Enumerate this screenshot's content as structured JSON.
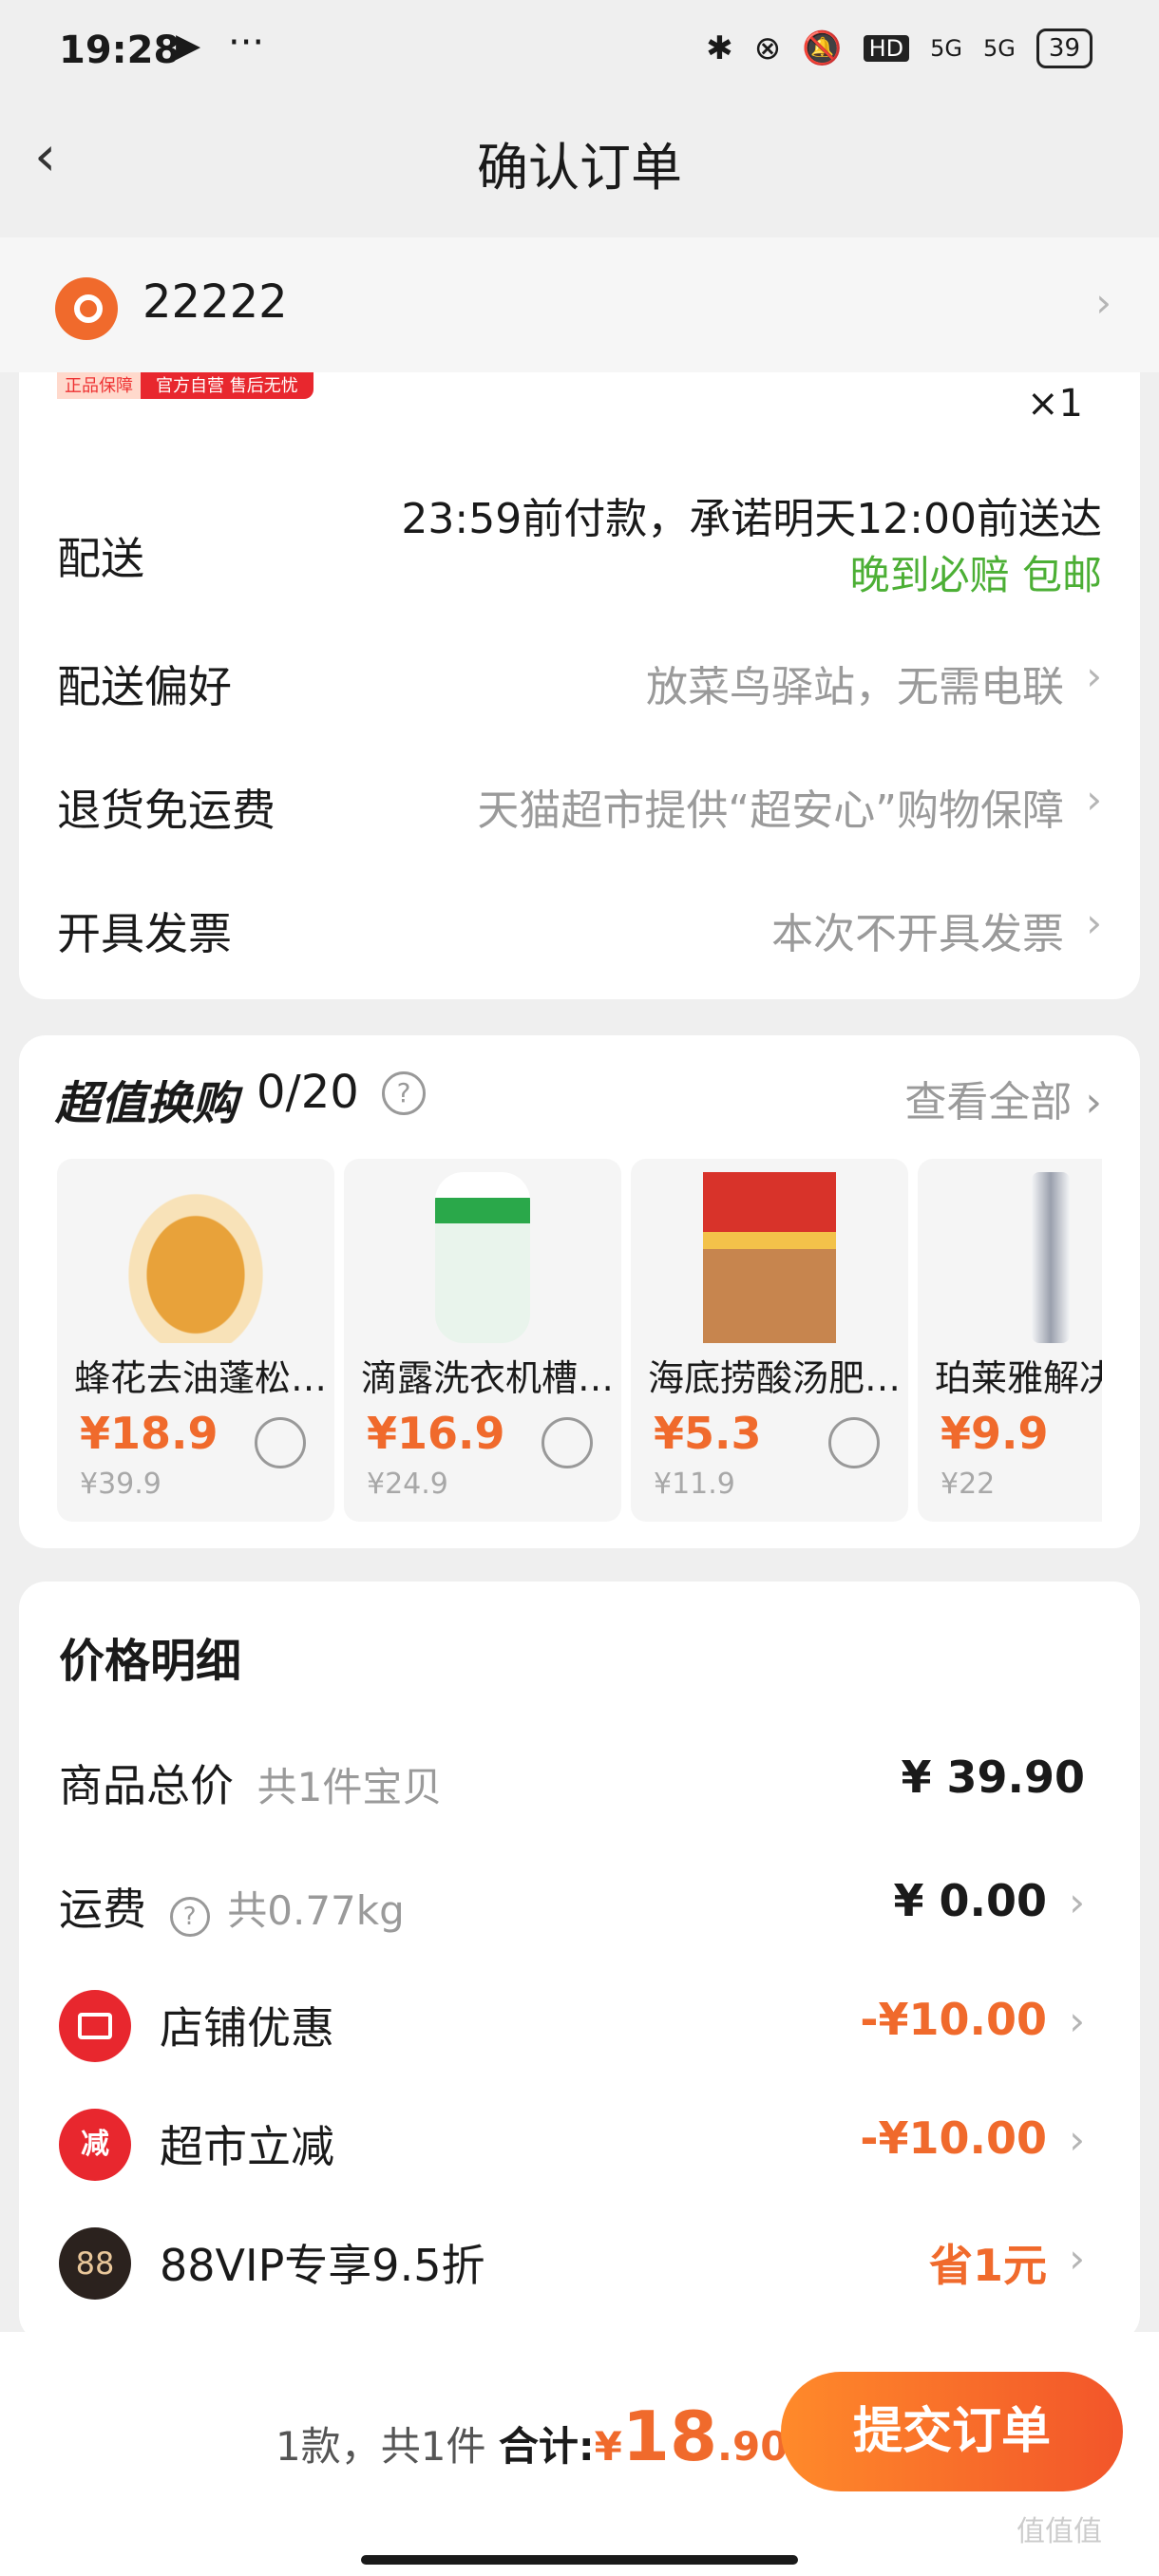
{
  "status": {
    "time": "19:28",
    "more": "···",
    "battery": "39",
    "hd": "HD",
    "net1": "5G",
    "net2": "5G"
  },
  "header": {
    "title": "确认订单",
    "back": "‹"
  },
  "address": {
    "text": "22222"
  },
  "badge": {
    "left": "正品保障",
    "right": "官方自营 售后无忧"
  },
  "item": {
    "qty": "×1"
  },
  "rows": {
    "delivery_label": "配送",
    "delivery_time": "23:59前付款，承诺明天12:00前送达",
    "delivery_promise": "晚到必赔 包邮",
    "pref_label": "配送偏好",
    "pref_value": "放菜鸟驿站，无需电联",
    "return_label": "退货免运费",
    "return_value": "天猫超市提供“超安心”购物保障",
    "invoice_label": "开具发票",
    "invoice_value": "本次不开具发票"
  },
  "swap": {
    "title": "超值换购",
    "count": "0/20",
    "view_all": "查看全部",
    "products": [
      {
        "name": "蜂花去油蓬松洗发水",
        "price": "¥18.9",
        "orig": "¥39.9",
        "color": "#e8a23a"
      },
      {
        "name": "滴露洗衣机槽清洗剂",
        "price": "¥16.9",
        "orig": "¥24.9",
        "color": "#2aa84a"
      },
      {
        "name": "海底捞酸汤肥牛调味料",
        "price": "¥5.3",
        "orig": "¥11.9",
        "color": "#d8332a"
      },
      {
        "name": "珀莱雅解决方案",
        "price": "¥9.9",
        "orig": "¥22",
        "color": "#9aa0ad"
      }
    ]
  },
  "price_detail": {
    "title": "价格明细",
    "goods_label": "商品总价",
    "goods_sub": "共1件宝贝",
    "goods_value": "¥ 39.90",
    "ship_label": "运费",
    "ship_sub": "共0.77kg",
    "ship_value": "¥ 0.00",
    "shop_label": "店铺优惠",
    "shop_value": "-¥10.00",
    "market_label": "超市立减",
    "market_value": "-¥10.00",
    "market_icon": "减",
    "vip_label": "88VIP专享9.5折",
    "vip_value": "省1元",
    "vip_icon": "88"
  },
  "footer": {
    "count": "1款，共1件",
    "total_label": "合计:",
    "currency": "¥",
    "total_int": "18",
    "total_dec": ".90",
    "submit": "提交订单",
    "watermark": "值值值"
  }
}
